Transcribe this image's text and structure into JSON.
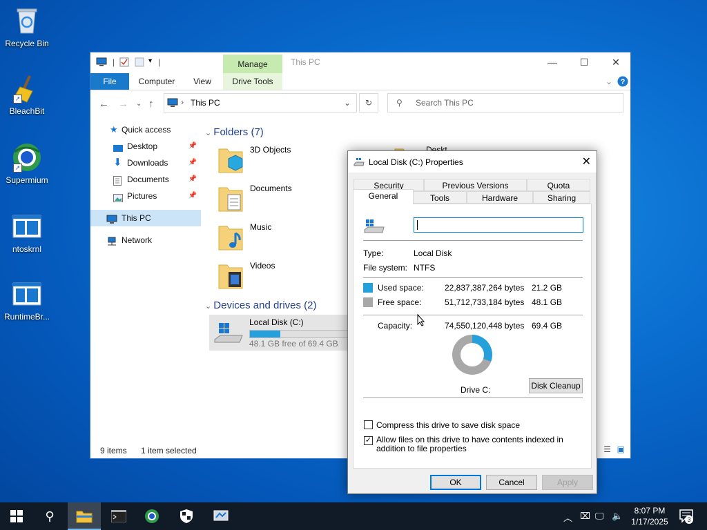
{
  "desktop": {
    "icons": [
      {
        "label": "Recycle Bin"
      },
      {
        "label": "BleachBit"
      },
      {
        "label": "Supermium"
      },
      {
        "label": "ntoskrnl"
      },
      {
        "label": "RuntimeBr..."
      }
    ]
  },
  "explorer": {
    "title": "This PC",
    "manage_label": "Manage",
    "ribbon_tabs": [
      "File",
      "Computer",
      "View",
      "Drive Tools"
    ],
    "address": "This PC",
    "search_placeholder": "Search This PC",
    "nav": {
      "quick_access": "Quick access",
      "pinned": [
        "Desktop",
        "Downloads",
        "Documents",
        "Pictures"
      ],
      "this_pc": "This PC",
      "network": "Network"
    },
    "folders_header": "Folders (7)",
    "folders": [
      "3D Objects",
      "Documents",
      "Music",
      "Videos"
    ],
    "folder_partial": "Deskt",
    "devices_header": "Devices and drives (2)",
    "drive": {
      "name": "Local Disk (C:)",
      "free_text": "48.1 GB free of 69.4 GB",
      "used_fraction": 0.305
    },
    "status": {
      "items": "9 items",
      "selected": "1 item selected"
    }
  },
  "dialog": {
    "title": "Local Disk (C:) Properties",
    "tabs_row1": [
      "Security",
      "Previous Versions",
      "Quota"
    ],
    "tabs_row2": [
      "General",
      "Tools",
      "Hardware",
      "Sharing"
    ],
    "name_value": "",
    "type_label": "Type:",
    "type_value": "Local Disk",
    "fs_label": "File system:",
    "fs_value": "NTFS",
    "used_label": "Used space:",
    "used_bytes": "22,837,387,264 bytes",
    "used_gb": "21.2 GB",
    "free_label": "Free space:",
    "free_bytes": "51,712,733,184 bytes",
    "free_gb": "48.1 GB",
    "capacity_label": "Capacity:",
    "capacity_bytes": "74,550,120,448 bytes",
    "capacity_gb": "69.4 GB",
    "drive_label": "Drive C:",
    "cleanup_label": "Disk Cleanup",
    "compress_label": "Compress this drive to save disk space",
    "compress_checked": false,
    "index_label": "Allow files on this drive to have contents indexed in addition to file properties",
    "index_checked": true,
    "used_fraction": 0.306,
    "colors": {
      "used": "#26a0da",
      "free": "#a8a8a8"
    },
    "buttons": {
      "ok": "OK",
      "cancel": "Cancel",
      "apply": "Apply"
    }
  },
  "taskbar": {
    "time": "8:07 PM",
    "date": "1/17/2025",
    "notification_count": "3",
    "icons": [
      "start-icon",
      "search-icon",
      "file-explorer-icon",
      "terminal-icon",
      "supermium-icon",
      "security-icon",
      "network-app-icon"
    ]
  }
}
